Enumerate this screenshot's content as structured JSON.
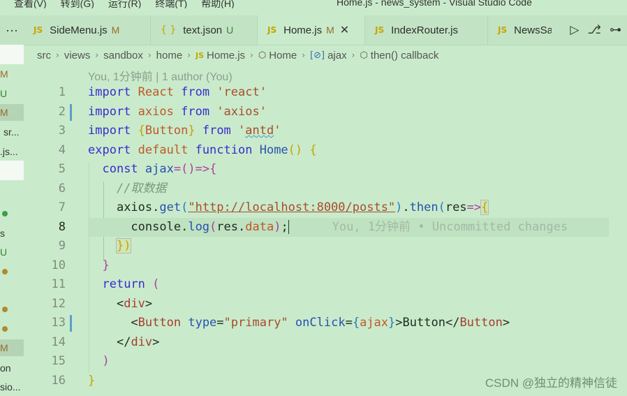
{
  "menubar": {
    "items": [
      "查看(V)",
      "转到(G)",
      "运行(R)",
      "终端(T)",
      "帮助(H)"
    ],
    "window_title": "Home.js - news_system - Visual Studio Code"
  },
  "tabs": [
    {
      "icon": "JS",
      "label": "SideMenu.js",
      "status": "M"
    },
    {
      "icon": "{ }",
      "label": "text.json",
      "status": "U"
    },
    {
      "icon": "JS",
      "label": "Home.js",
      "status": "M",
      "close": "✕"
    },
    {
      "icon": "JS",
      "label": "IndexRouter.js",
      "status": ""
    },
    {
      "icon": "JS",
      "label": "NewsSa",
      "status": ""
    }
  ],
  "overflow_dots": "···",
  "breadcrumb": [
    "src",
    "views",
    "sandbox",
    "home",
    "Home.js",
    "Home",
    "ajax",
    "then() callback"
  ],
  "sidebar": {
    "status_letters": [
      "M",
      "U",
      "M",
      "U",
      "M"
    ],
    "fragments": [
      "sr...",
      ".js...",
      "s",
      "on",
      "sio..."
    ]
  },
  "blame_header": "You, 1分钟前 | 1 author (You)",
  "inline_blame": "You, 1分钟前 • Uncommitted changes",
  "line_numbers": [
    "1",
    "2",
    "3",
    "4",
    "5",
    "6",
    "7",
    "8",
    "9",
    "10",
    "11",
    "12",
    "13",
    "14",
    "15",
    "16"
  ],
  "current_line": "8",
  "code": {
    "l1": {
      "kw1": "import",
      "name": "React",
      "kw2": "from",
      "src": "'react'"
    },
    "l2": {
      "kw1": "import",
      "name": "axios",
      "kw2": "from",
      "src": "'axios'"
    },
    "l3": {
      "kw1": "import",
      "lb": "{",
      "name": "Button",
      "rb": "}",
      "kw2": "from",
      "q1": "'",
      "src": "antd",
      "q2": "'"
    },
    "l4": {
      "kw1": "export",
      "kw2": "default",
      "kw3": "function",
      "name": "Home",
      "parens": "()",
      "brace": "{"
    },
    "l5": {
      "kw": "const",
      "name": "ajax",
      "arrow": "=()=>",
      "brace": "{"
    },
    "l6": {
      "comment": "//取数据"
    },
    "l7": {
      "obj": "axios",
      "dot": ".",
      "method": "get",
      "lp": "(",
      "url": "\"http://localhost:8000/posts\"",
      "rp": ")",
      "dot2": ".",
      "then": "then",
      "lp2": "(",
      "arg": "res",
      "arrow": "=>",
      "brace": "{"
    },
    "l8": {
      "obj": "console",
      "dot": ".",
      "method": "log",
      "lp": "(",
      "arg": "res",
      "dot2": ".",
      "prop": "data",
      "rp": ")",
      "semi": ";"
    },
    "l9": {
      "close": "})"
    },
    "l10": {
      "close": "}"
    },
    "l11": {
      "kw": "return",
      "paren": "("
    },
    "l12": {
      "lt": "<",
      "tag": "div",
      "gt": ">"
    },
    "l13": {
      "lt": "<",
      "tag": "Button",
      "attr": "type",
      "eq": "=",
      "val": "\"primary\"",
      "attr2": "onClick",
      "eq2": "=",
      "lb": "{",
      "expr": "ajax",
      "rb": "}",
      "gt": ">",
      "text": "Button",
      "close_lt": "</",
      "close_tag": "Button",
      "close_gt": ">"
    },
    "l14": {
      "lt": "</",
      "tag": "div",
      "gt": ">"
    },
    "l15": {
      "paren": ")"
    },
    "l16": {
      "brace": "}"
    }
  },
  "watermark": "CSDN @独立的精神信徒",
  "colors": {
    "background": "#c9ebcb",
    "keyword": "#3a2bd0",
    "string": "#a84c2c",
    "modified": "#9a6b2c",
    "untracked": "#3e7f3a"
  }
}
